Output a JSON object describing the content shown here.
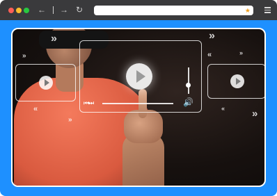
{
  "browser": {
    "title_bar_color": "#3a3a3c",
    "content_bg_color": "#1e90ff",
    "controls": {
      "back_icon": "arrow-left-icon",
      "forward_icon": "arrow-right-icon",
      "reload_icon": "reload-icon",
      "bookmark_icon": "star-icon",
      "menu_icon": "hamburger-menu-icon"
    },
    "url": ""
  },
  "hero": {
    "description_icons": [
      "play-icon",
      "previous-icon",
      "next-icon",
      "volume-icon",
      "chevron-arrows-icon"
    ]
  },
  "glyphs": {
    "back": "←",
    "forward": "→",
    "reload": "↻",
    "star": "★",
    "prevnext": "⏮⏭",
    "volume": "🔊",
    "chev_right": "»",
    "chev_left": "«"
  }
}
